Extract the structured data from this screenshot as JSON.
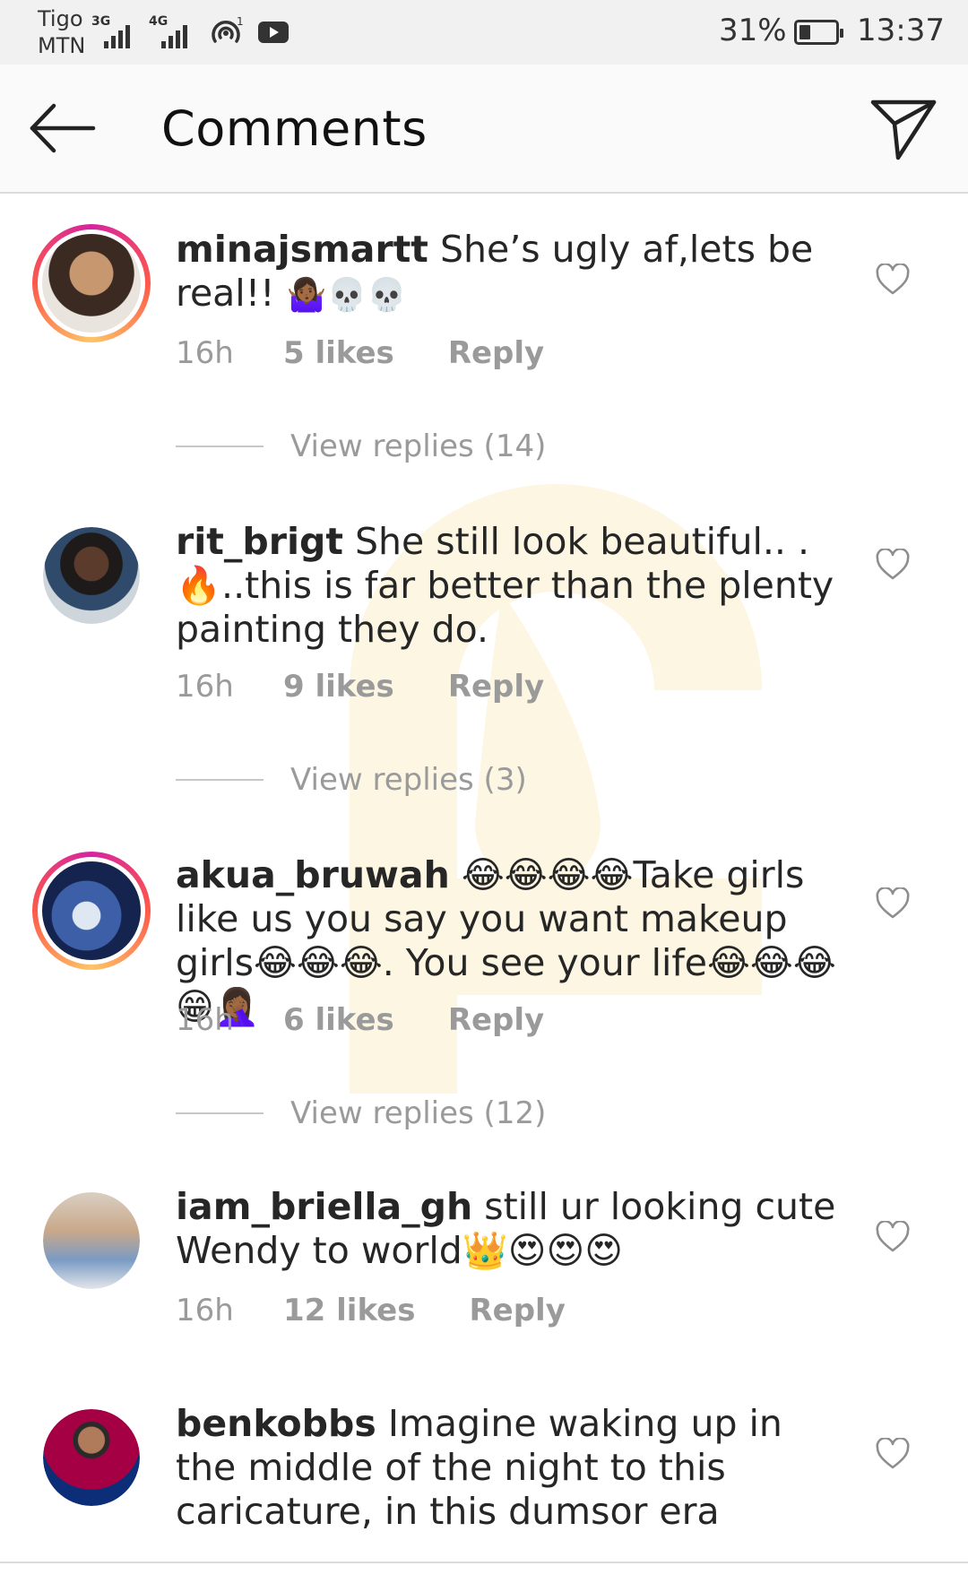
{
  "status_bar": {
    "carrier_1": "Tigo",
    "carrier_2": "MTN",
    "network_1": "3G",
    "network_2": "4G",
    "hotspot_count": "1",
    "battery_percent": "31%",
    "battery_level": 0.31,
    "time": "13:37"
  },
  "header": {
    "title": "Comments",
    "back_icon": "arrow-left-icon",
    "send_icon": "paper-plane-icon"
  },
  "comments": [
    {
      "username": "minajsmartt",
      "text": "She’s ugly af,lets be real!!",
      "emoji": "🤷🏾‍♀️💀💀",
      "time": "16h",
      "likes": "5 likes",
      "reply": "Reply",
      "view_replies": "View replies (14)"
    },
    {
      "username": "rit_brigt",
      "text": "She still look beautiful.. .",
      "text_2": "🔥..this is far better than the plenty painting they do.",
      "time": "16h",
      "likes": "9 likes",
      "reply": "Reply",
      "view_replies": "View replies (3)"
    },
    {
      "username": "akua_bruwah",
      "text": "😂😂😂😂Take girls like us you say you want makeup girls😂😂😂. You see your life😂😂😂😁🤦🏾‍♀️",
      "time": "16h",
      "likes": "6 likes",
      "reply": "Reply",
      "view_replies": "View replies (12)"
    },
    {
      "username": "iam_briella_gh",
      "text": "still ur looking cute Wendy to world👑😍😍😍",
      "time": "16h",
      "likes": "12 likes",
      "reply": "Reply"
    },
    {
      "username": "benkobbs",
      "text": "Imagine waking up in the middle of the night to this caricature, in this dumsor era"
    }
  ],
  "colors": {
    "story_ring": "#d6249f",
    "meta_text": "#9a9a9a",
    "watermark": "#e8b400"
  }
}
